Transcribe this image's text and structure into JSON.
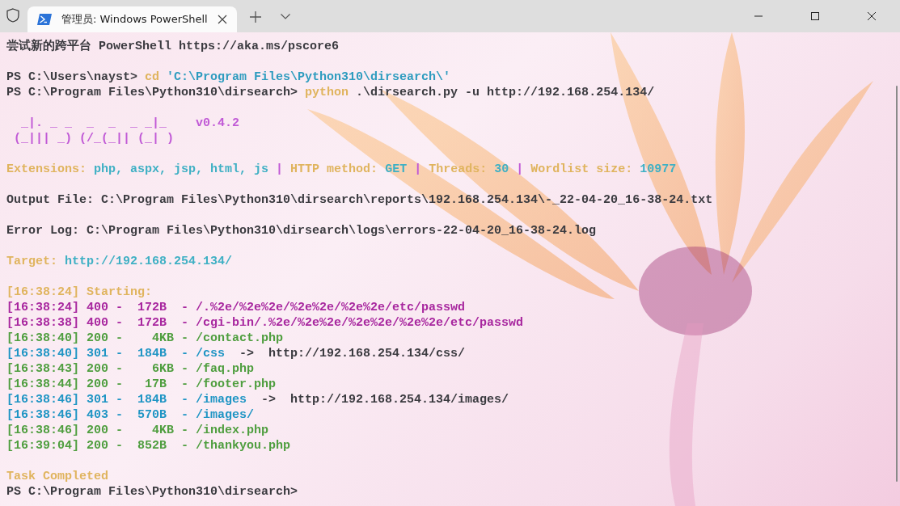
{
  "tab": {
    "title": "管理员: Windows PowerShell",
    "selected": true
  },
  "lines": [
    {
      "kind": "text",
      "segments": [
        {
          "text": "尝试新的跨平台 PowerShell https://aka.ms/pscore6",
          "color": "#3b3b40"
        }
      ]
    },
    {
      "kind": "blank"
    },
    {
      "kind": "text",
      "segments": [
        {
          "text": "PS C:\\Users\\nayst> ",
          "color": "#3b3b40"
        },
        {
          "text": "cd ",
          "color": "#e0b45e"
        },
        {
          "text": "'C:\\Program Files\\Python310\\dirsearch\\'",
          "color": "#2e9cbf"
        }
      ]
    },
    {
      "kind": "text",
      "segments": [
        {
          "text": "PS C:\\Program Files\\Python310\\dirsearch> ",
          "color": "#3b3b40"
        },
        {
          "text": "python ",
          "color": "#e0b45e"
        },
        {
          "text": ".\\dirsearch.py -u http://192.168.254.134/",
          "color": "#3b3b40"
        }
      ]
    },
    {
      "kind": "blank"
    },
    {
      "kind": "text",
      "segments": [
        {
          "text": "  _|. _ _  _  _  _ _|_    ",
          "color": "#c15ad6"
        },
        {
          "text": "v0.4.2",
          "color": "#c15ad6"
        }
      ]
    },
    {
      "kind": "text",
      "segments": [
        {
          "text": " (_||| _) (/_(_|| (_| )",
          "color": "#c15ad6"
        }
      ]
    },
    {
      "kind": "blank"
    },
    {
      "kind": "text",
      "segments": [
        {
          "text": "Extensions: ",
          "color": "#e0b45e"
        },
        {
          "text": "php, aspx, jsp, html, js ",
          "color": "#3fb0c4"
        },
        {
          "text": "|",
          "color": "#c15ad6"
        },
        {
          "text": " HTTP method: ",
          "color": "#e0b45e"
        },
        {
          "text": "GET ",
          "color": "#3fb0c4"
        },
        {
          "text": "|",
          "color": "#c15ad6"
        },
        {
          "text": " Threads: ",
          "color": "#e0b45e"
        },
        {
          "text": "30 ",
          "color": "#3fb0c4"
        },
        {
          "text": "|",
          "color": "#c15ad6"
        },
        {
          "text": " Wordlist size: ",
          "color": "#e0b45e"
        },
        {
          "text": "10977",
          "color": "#3fb0c4"
        }
      ]
    },
    {
      "kind": "blank"
    },
    {
      "kind": "text",
      "segments": [
        {
          "text": "Output File: C:\\Program Files\\Python310\\dirsearch\\reports\\192.168.254.134\\-_22-04-20_16-38-24.txt",
          "color": "#3b3b40"
        }
      ]
    },
    {
      "kind": "blank"
    },
    {
      "kind": "text",
      "segments": [
        {
          "text": "Error Log: C:\\Program Files\\Python310\\dirsearch\\logs\\errors-22-04-20_16-38-24.log",
          "color": "#3b3b40"
        }
      ]
    },
    {
      "kind": "blank"
    },
    {
      "kind": "text",
      "segments": [
        {
          "text": "Target: ",
          "color": "#e0b45e"
        },
        {
          "text": "http://192.168.254.134/",
          "color": "#3fb0c4"
        }
      ]
    },
    {
      "kind": "blank"
    },
    {
      "kind": "text",
      "segments": [
        {
          "text": "[16:38:24] Starting:",
          "color": "#e0b45e"
        }
      ]
    },
    {
      "kind": "text",
      "segments": [
        {
          "text": "[16:38:24] 400 -  172B  - /.%2e/%2e%2e/%2e%2e/%2e%2e/etc/passwd",
          "color": "#a8279f"
        }
      ]
    },
    {
      "kind": "text",
      "segments": [
        {
          "text": "[16:38:38] 400 -  172B  - /cgi-bin/.%2e/%2e%2e/%2e%2e/%2e%2e/etc/passwd",
          "color": "#a8279f"
        }
      ]
    },
    {
      "kind": "text",
      "segments": [
        {
          "text": "[16:38:40] 200 -    4KB - /contact.php",
          "color": "#4f9e3f"
        }
      ]
    },
    {
      "kind": "text",
      "segments": [
        {
          "text": "[16:38:40] 301 -  184B  - /css",
          "color": "#1f95c4"
        },
        {
          "text": "  ->  http://192.168.254.134/css/",
          "color": "#3b3b40"
        }
      ]
    },
    {
      "kind": "text",
      "segments": [
        {
          "text": "[16:38:43] 200 -    6KB - /faq.php",
          "color": "#4f9e3f"
        }
      ]
    },
    {
      "kind": "text",
      "segments": [
        {
          "text": "[16:38:44] 200 -   17B  - /footer.php",
          "color": "#4f9e3f"
        }
      ]
    },
    {
      "kind": "text",
      "segments": [
        {
          "text": "[16:38:46] 301 -  184B  - /images",
          "color": "#1f95c4"
        },
        {
          "text": "  ->  http://192.168.254.134/images/",
          "color": "#3b3b40"
        }
      ]
    },
    {
      "kind": "text",
      "segments": [
        {
          "text": "[16:38:46] 403 -  570B  - /images/",
          "color": "#1f95c4"
        }
      ]
    },
    {
      "kind": "text",
      "segments": [
        {
          "text": "[16:38:46] 200 -    4KB - /index.php",
          "color": "#4f9e3f"
        }
      ]
    },
    {
      "kind": "text",
      "segments": [
        {
          "text": "[16:39:04] 200 -  852B  - /thankyou.php",
          "color": "#4f9e3f"
        }
      ]
    },
    {
      "kind": "blank"
    },
    {
      "kind": "text",
      "segments": [
        {
          "text": "Task Completed",
          "color": "#e0b45e"
        }
      ]
    },
    {
      "kind": "text",
      "segments": [
        {
          "text": "PS C:\\Program Files\\Python310\\dirsearch>",
          "color": "#3b3b40"
        }
      ]
    }
  ]
}
